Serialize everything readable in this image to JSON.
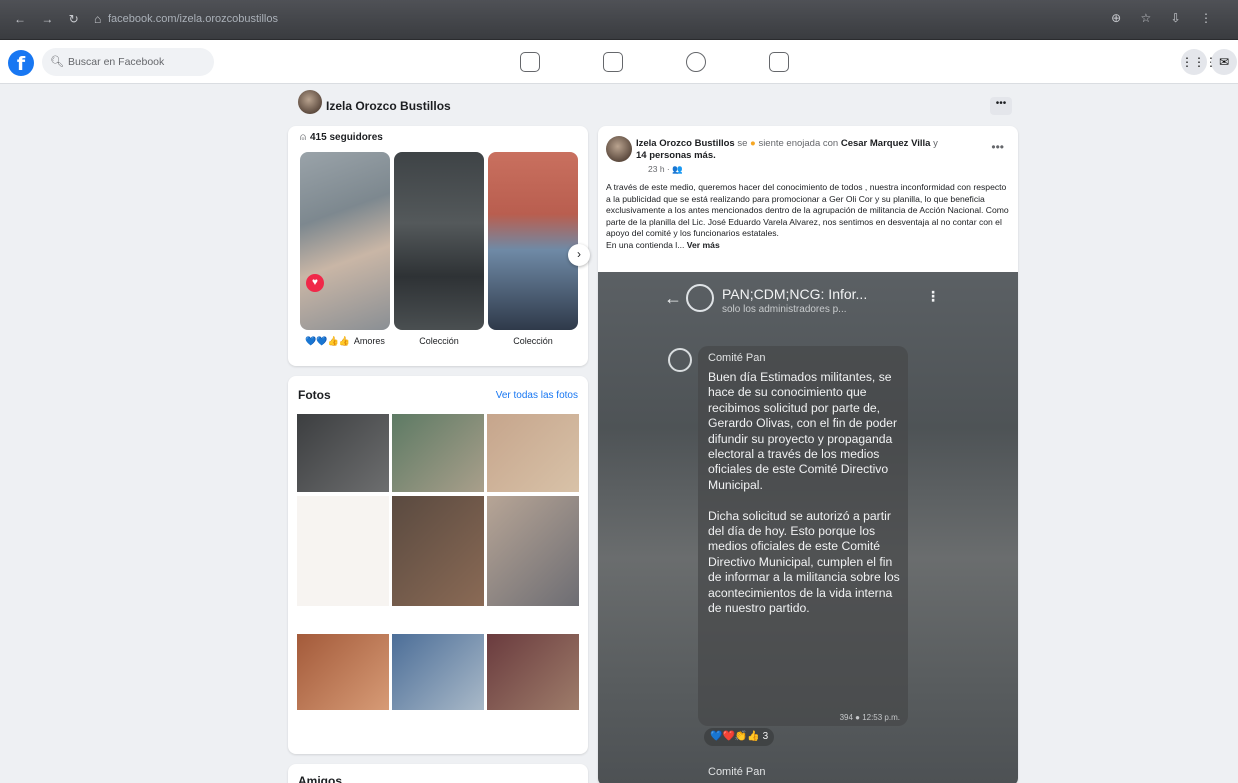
{
  "browser": {
    "url": "facebook.com/izela.orozcobustillos",
    "nav_glyphs": "← → ↻ ⌂",
    "tools_glyphs": "⊕ ☆ ⇩ ⋮"
  },
  "facebook": {
    "logo": "f",
    "search_placeholder": "Buscar en Facebook",
    "nav_icons": [
      "home-icon",
      "video-icon",
      "groups-icon",
      "gaming-icon"
    ],
    "apps_glyph": "⋮⋮⋮",
    "messenger_glyph": "✉"
  },
  "profile": {
    "name": "Izela Orozco Bustillos",
    "more_label": "•••"
  },
  "stories": {
    "followers": "415 seguidores",
    "items": [
      {
        "label": "Amores",
        "reactions": "💙💙👍👍"
      },
      {
        "label": "Colección"
      },
      {
        "label": "Colección"
      }
    ]
  },
  "photos": {
    "title": "Fotos",
    "see_all": "Ver todas las fotos"
  },
  "friends": {
    "title": "Amigos"
  },
  "post": {
    "author": "Izela Orozco Bustillos",
    "feeling_prefix": "se",
    "feeling": "siente enojada con",
    "tagged": "Cesar Marquez Villa",
    "tagged_connector": "y",
    "others": "14 personas más.",
    "time": "23 h · 👥",
    "text": "A través de este medio, queremos hacer del conocimiento de todos , nuestra inconformidad con respecto a la publicidad que se está realizando para promocionar a Ger Oli Cor y su planilla, lo que beneficia exclusivamente a los antes mencionados dentro de la agrupación de militancia de Acción Nacional. Como parte de la planilla del Lic. José Eduardo Varela Alvarez, nos sentimos en desventaja al no contar con el apoyo del comité y los funcionarios estatales.",
    "text_tail": "En una contienda l...",
    "see_more": "Ver más",
    "image": {
      "channel_name": "PAN;CDM;NCG: Infor...",
      "channel_sub": "solo los administradores p...",
      "sender": "Comité Pan",
      "message": "Buen día Estimados militantes, se hace de su conocimiento que recibimos solicitud por parte de, Gerardo Olivas, con el fin de poder difundir su proyecto y propaganda electoral a través de los medios oficiales de este Comité Directivo Municipal.\n\nDicha solicitud se autorizó a partir del día de hoy. Esto porque los medios oficiales de este Comité Directivo Municipal, cumplen el fin de informar a la militancia sobre los acontecimientos de la vida interna de nuestro partido.",
      "stamp": "394 ● 12:53 p.m.",
      "reactions": "💙❤️👏👍 3",
      "next_sender": "Comité Pan"
    }
  }
}
